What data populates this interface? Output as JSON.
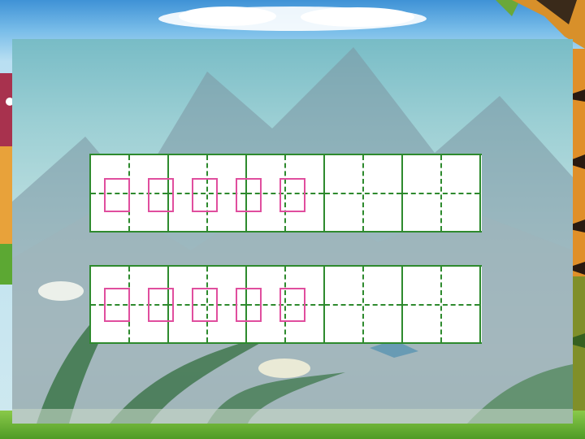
{
  "scene": {
    "elements": [
      "sky",
      "cloud",
      "mountains",
      "reeds",
      "tiger-figure",
      "cartoon-figure",
      "grass"
    ]
  },
  "writing_grid": {
    "rows": 2,
    "cells_per_row": 5,
    "pink_boxes_per_row": 5,
    "colors": {
      "grid_line": "#2e8a2e",
      "pink_box": "#e04e9e",
      "cell_fill": "#ffffff"
    }
  }
}
